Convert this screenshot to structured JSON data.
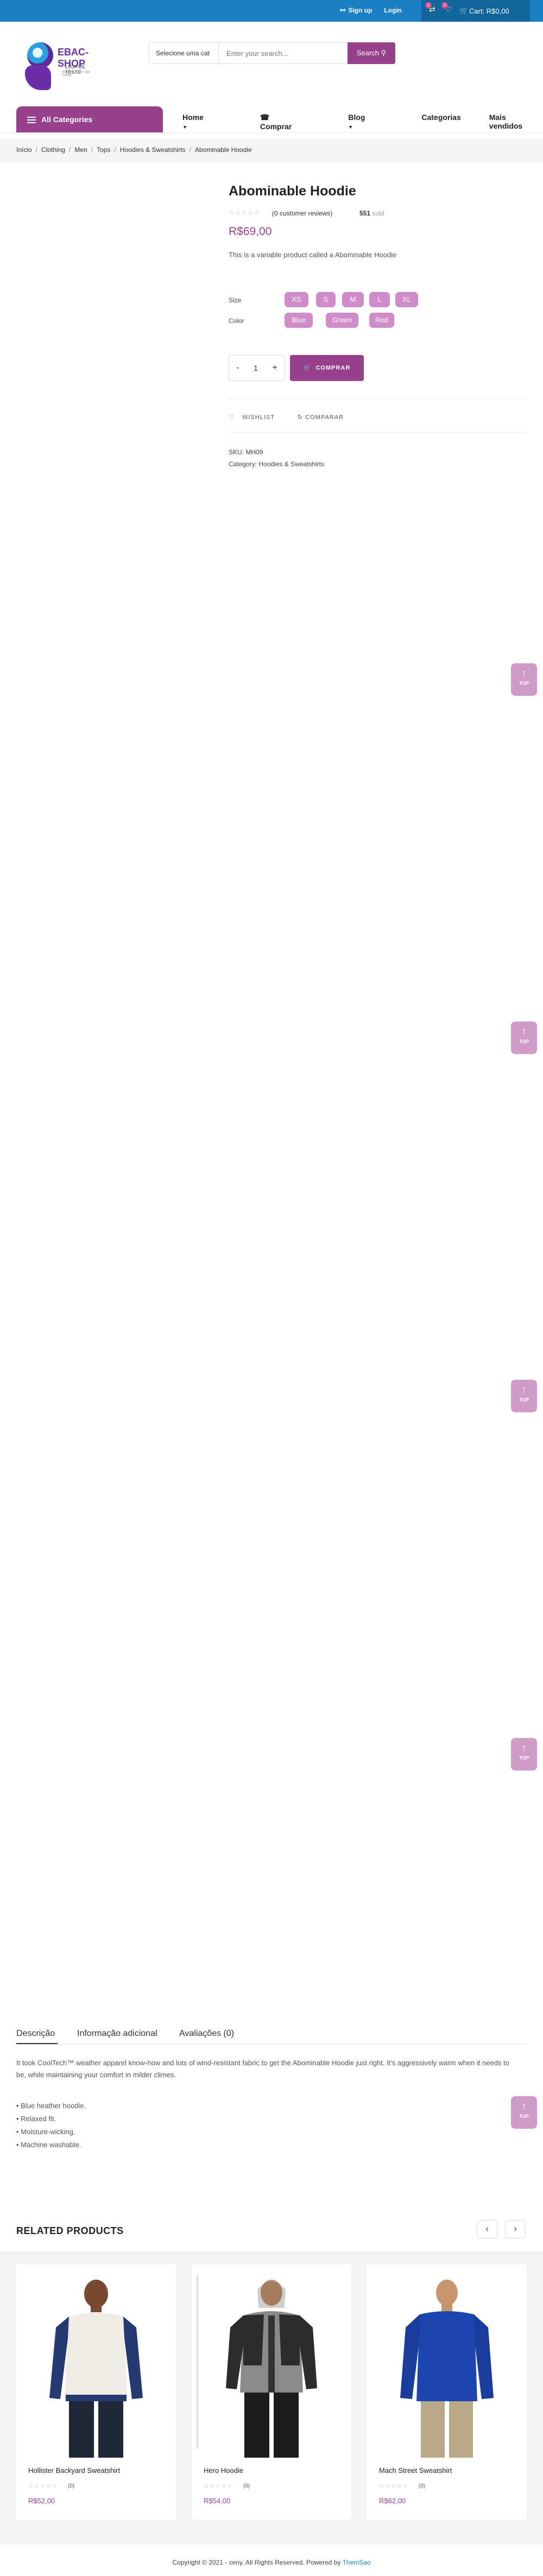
{
  "topbar": {
    "signup": "Sign up",
    "login": "Login",
    "compare_count": "0",
    "wishlist_count": "0",
    "cart_label": "Cart: R$0,00"
  },
  "header": {
    "brand": "EBAC-SHOP",
    "tagline": "LOJA DE TESTE",
    "subline": "Automação de Loja Virtual",
    "search_category": "Selecione uma cat",
    "search_placeholder": "Enter your search...",
    "search_button": "Search"
  },
  "nav": {
    "all_categories": "All Categories",
    "items": [
      "Home",
      "Comprar",
      "Blog",
      "Categorias",
      "Mais vendidos"
    ]
  },
  "breadcrumb": [
    "Início",
    "Clothing",
    "Men",
    "Tops",
    "Hoodies & Sweatshirts",
    "Abominable Hoodie"
  ],
  "product": {
    "title": "Abominable Hoodie",
    "reviews": "(0 customer reviews)",
    "sold_count": "551",
    "sold_label": "sold",
    "price": "R$69,00",
    "short_description": "This is a variable product called a Abominable Hoodie",
    "size_label": "Size",
    "sizes": [
      "XS",
      "S",
      "M",
      "L",
      "XL"
    ],
    "color_label": "Color",
    "colors": [
      "Blue",
      "Green",
      "Red"
    ],
    "quantity": "1",
    "buy_button": "COMPRAR",
    "wishlist": "WISHLIST",
    "compare": "COMPARAR",
    "sku": "SKU: MH09",
    "category": "Category: Hoodies & Sweatshirts"
  },
  "top_button": "TOP",
  "tabs": {
    "items": [
      "Descrição",
      "Informação adicional",
      "Avaliações (0)"
    ],
    "description": "It took CoolTech™ weather apparel know-how and lots of wind-resistant fabric to get the Abominable Hoodie just right. It's aggressively warm when it needs to be, while maintaining your comfort in milder climes.",
    "bullets": [
      "• Blue heather hoodie.",
      "• Relaxed fit.",
      "• Moisture-wicking.",
      "• Machine washable."
    ]
  },
  "related": {
    "title": "RELATED PRODUCTS",
    "products": [
      {
        "name": "Hollister Backyard Sweatshirt",
        "reviews": "(0)",
        "price": "R$52,00"
      },
      {
        "name": "Hero Hoodie",
        "reviews": "(0)",
        "price": "R$54,00"
      },
      {
        "name": "Mach Street Sweatshirt",
        "reviews": "(0)",
        "price": "R$62,00"
      }
    ]
  },
  "footer": {
    "copyright": "Copyright © 2021 - ceny. All Rights Reserved. Powered by",
    "powered": "ThemSao"
  },
  "colors": {
    "brand_purple": "#97418c",
    "swatch_pink": "#d08cc8",
    "topbar_blue": "#1b80c3"
  }
}
